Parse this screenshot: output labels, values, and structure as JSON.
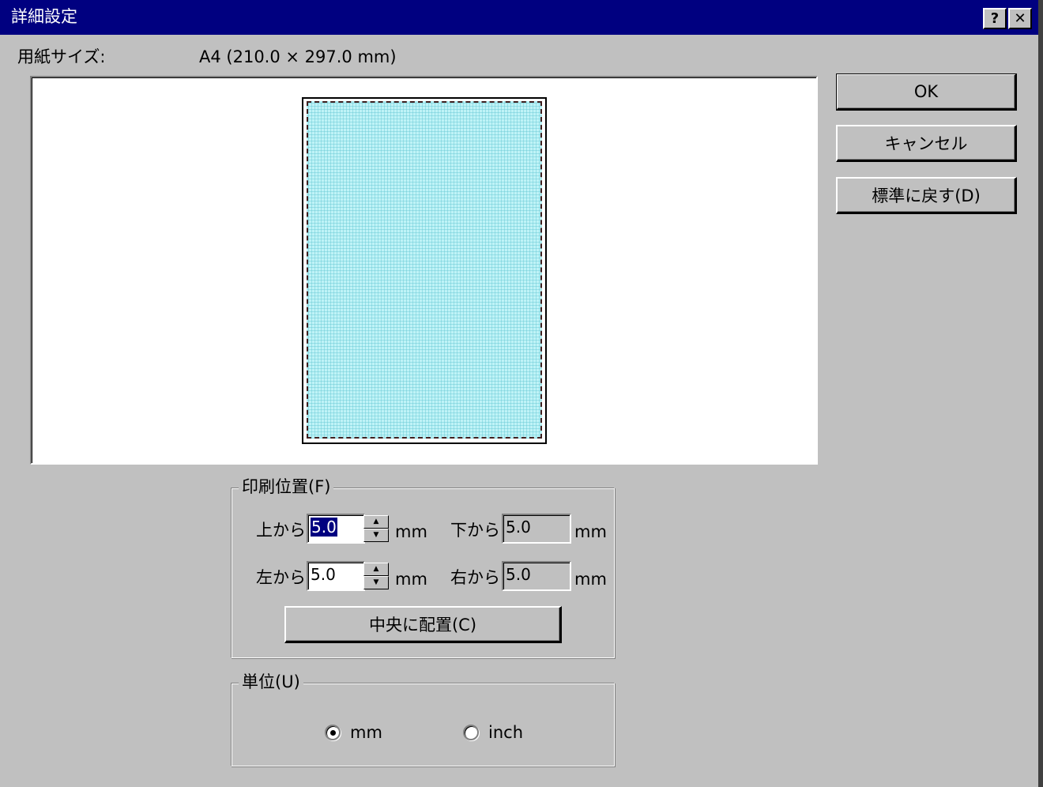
{
  "window": {
    "title": "詳細設定",
    "help_glyph": "?",
    "close_glyph": "✕"
  },
  "paper": {
    "label": "用紙サイズ:",
    "value": "A4 (210.0 × 297.0 mm)"
  },
  "buttons": {
    "ok": "OK",
    "cancel": "キャンセル",
    "reset": "標準に戻す(D)"
  },
  "print_position": {
    "legend": "印刷位置(F)",
    "top_label": "上から",
    "top_value": "5.0",
    "bottom_label": "下から",
    "bottom_value": "5.0",
    "left_label": "左から",
    "left_value": "5.0",
    "right_label": "右から",
    "right_value": "5.0",
    "unit": "mm",
    "center_button": "中央に配置(C)"
  },
  "units": {
    "legend": "単位(U)",
    "options": [
      "mm",
      "inch"
    ],
    "selected": "mm"
  }
}
